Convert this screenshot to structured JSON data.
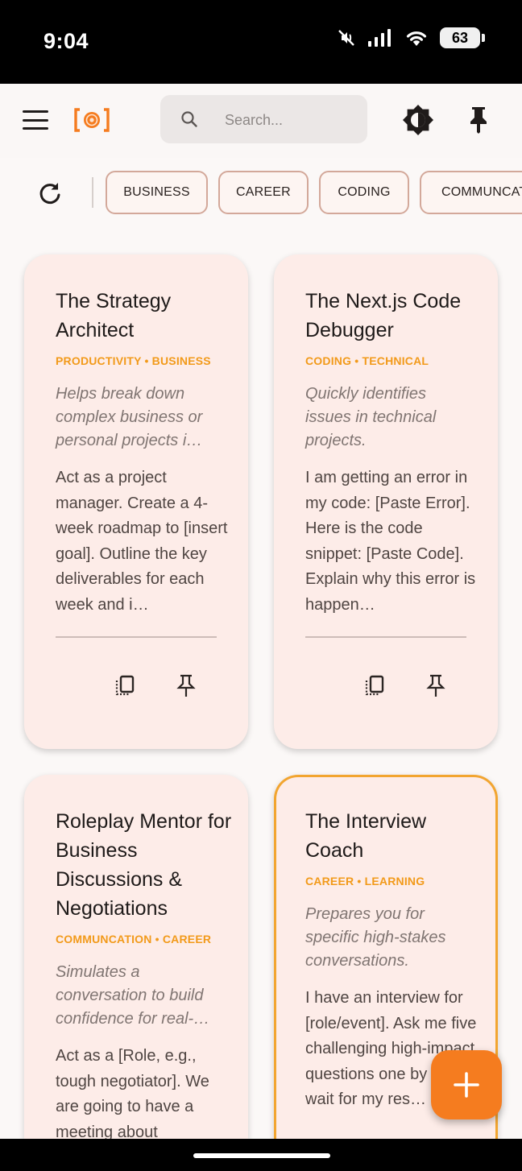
{
  "status_bar": {
    "time": "9:04",
    "battery": "63"
  },
  "app_bar": {
    "search_placeholder": "Search..."
  },
  "filters": [
    "BUSINESS",
    "CAREER",
    "CODING",
    "COMMUNCAT"
  ],
  "cards": [
    {
      "title": "The Strategy Architect",
      "tags": "PRODUCTIVITY • BUSINESS",
      "description": "Helps break down complex business or personal projects i…",
      "body": "Act as a project manager. Create a 4-week roadmap to [insert goal]. Outline the key deliverables for each week and i…"
    },
    {
      "title": "The Next.js Code Debugger",
      "tags": "CODING • TECHNICAL",
      "description": "Quickly identifies issues in technical projects.",
      "body": "I am getting an error in my code: [Paste Error]. Here is the code snippet: [Paste Code]. Explain why this error is happen…"
    },
    {
      "title": "Roleplay Mentor for Business Discussions & Negotiations",
      "tags": "COMMUNCATION • CAREER",
      "description": "Simulates a conversation to build confidence for real-…",
      "body": "Act as a [Role, e.g., tough negotiator]. We are going to have a meeting about"
    },
    {
      "title": "The Interview Coach",
      "tags": "CAREER • LEARNING",
      "description": "Prepares you for specific high-stakes conversations.",
      "body": "I have an interview for [role/event]. Ask me five challenging high-impact questions one by one, wait for my res…"
    }
  ],
  "colors": {
    "accent": "#f57c1f",
    "tag": "#f29a1a",
    "card_bg": "#fdece8",
    "highlight_border": "#f2a530"
  },
  "icons": [
    "menu-icon",
    "logo-icon",
    "search-icon",
    "theme-toggle-icon",
    "pin-icon",
    "refresh-icon",
    "copy-icon",
    "add-icon"
  ]
}
